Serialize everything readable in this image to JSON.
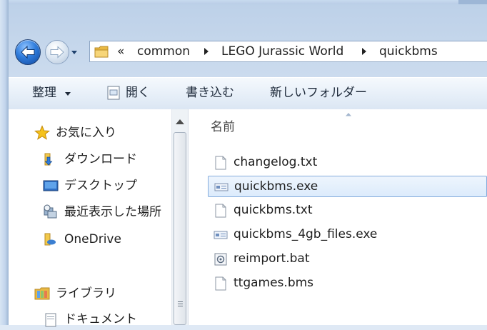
{
  "window": {
    "address_bar": {
      "prefix": "«",
      "breadcrumbs": [
        "common",
        "LEGO Jurassic World",
        "quickbms"
      ]
    }
  },
  "toolbar": {
    "organize_label": "整理",
    "open_label": "開く",
    "burn_label": "書き込む",
    "new_folder_label": "新しいフォルダー"
  },
  "nav_pane": {
    "favorites": {
      "label": "お気に入り",
      "items": [
        {
          "label": "ダウンロード",
          "icon": "downloads-folder-icon"
        },
        {
          "label": "デスクトップ",
          "icon": "desktop-icon"
        },
        {
          "label": "最近表示した場所",
          "icon": "recent-places-icon"
        },
        {
          "label": "OneDrive",
          "icon": "onedrive-folder-icon"
        }
      ]
    },
    "libraries": {
      "label": "ライブラリ",
      "items": [
        {
          "label": "ドキュメント",
          "icon": "documents-icon"
        }
      ]
    }
  },
  "file_list": {
    "column_name": "名前",
    "files": [
      {
        "name": "changelog.txt",
        "icon": "text-file-icon",
        "selected": false
      },
      {
        "name": "quickbms.exe",
        "icon": "exe-file-icon",
        "selected": true
      },
      {
        "name": "quickbms.txt",
        "icon": "text-file-icon",
        "selected": false
      },
      {
        "name": "quickbms_4gb_files.exe",
        "icon": "exe-file-icon",
        "selected": false
      },
      {
        "name": "reimport.bat",
        "icon": "batch-file-icon",
        "selected": false
      },
      {
        "name": "ttgames.bms",
        "icon": "generic-file-icon",
        "selected": false
      }
    ]
  },
  "colors": {
    "selection_bg": "#dcebfc",
    "selection_border": "#84acdd",
    "folder_yellow": "#f2c94c",
    "accent_blue": "#2f7cdc"
  }
}
